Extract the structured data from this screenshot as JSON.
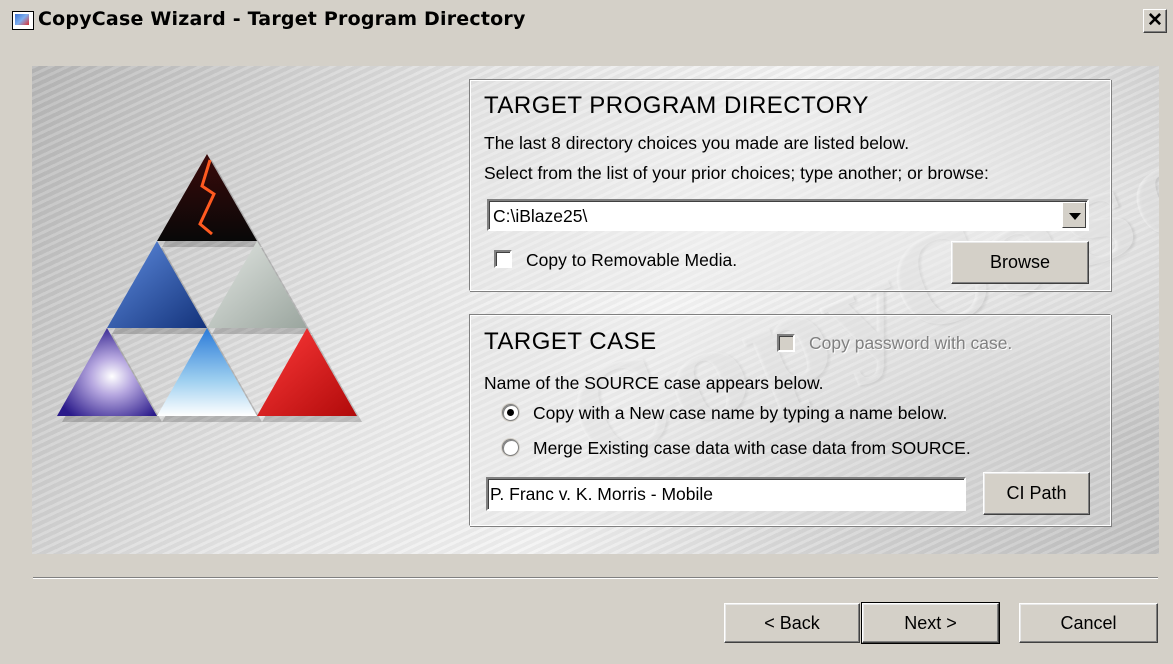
{
  "window": {
    "title": "CopyCase Wizard - Target Program Directory",
    "close_glyph": "✕"
  },
  "banner": {
    "watermark_text": "CopyCase",
    "logo_icon": "triangle-pyramid-logo-icon"
  },
  "directory_section": {
    "heading": "TARGET  PROGRAM  DIRECTORY",
    "line1": "The last 8 directory choices you made are listed below.",
    "line2": "Select from the list of your prior choices; type another; or browse:",
    "directory_value": "C:\\iBlaze25\\",
    "removable_media_label": "Copy to Removable Media.",
    "removable_media_checked": false,
    "browse_label": "Browse"
  },
  "case_section": {
    "heading": "TARGET  CASE",
    "copy_password_label": "Copy password with case.",
    "copy_password_enabled": false,
    "instruction": "Name of the SOURCE case appears below.",
    "radio_new_label": "Copy with a New case name by typing a name below.",
    "radio_merge_label": "Merge Existing case data with case data from SOURCE.",
    "selected_option": "new",
    "case_name_value": "P. Franc v. K. Morris - Mobile",
    "ci_path_label": "CI Path"
  },
  "footer": {
    "back_label": "< Back",
    "next_label": "Next >",
    "cancel_label": "Cancel"
  }
}
